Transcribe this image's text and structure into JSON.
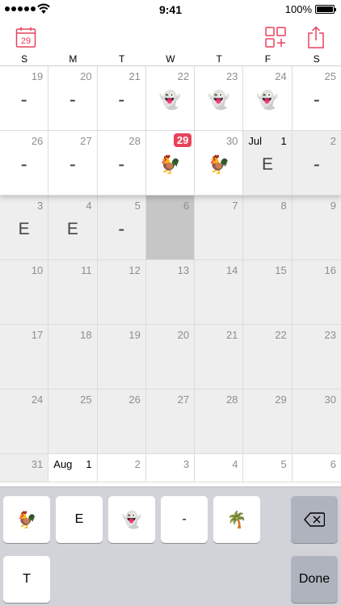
{
  "status_bar": {
    "time": "9:41",
    "battery": "100%"
  },
  "toolbar": {
    "calendar_day": "29",
    "left_icon": "calendar-icon",
    "grid_icon": "grid-add-icon",
    "share_icon": "share-icon",
    "accent": "#e8425a"
  },
  "weekdays": [
    "S",
    "M",
    "T",
    "W",
    "T",
    "F",
    "S"
  ],
  "weeks": [
    [
      {
        "day": "19",
        "mark": "-",
        "state": "active"
      },
      {
        "day": "20",
        "mark": "-",
        "state": "active"
      },
      {
        "day": "21",
        "mark": "-",
        "state": "active"
      },
      {
        "day": "22",
        "mark": "👻",
        "state": "active"
      },
      {
        "day": "23",
        "mark": "👻",
        "state": "active"
      },
      {
        "day": "24",
        "mark": "👻",
        "state": "active"
      },
      {
        "day": "25",
        "mark": "-",
        "state": "active"
      }
    ],
    [
      {
        "day": "26",
        "mark": "-",
        "state": "active"
      },
      {
        "day": "27",
        "mark": "-",
        "state": "active"
      },
      {
        "day": "28",
        "mark": "-",
        "state": "active"
      },
      {
        "day": "29",
        "mark": "🐓",
        "state": "active",
        "today": true
      },
      {
        "day": "30",
        "mark": "🐓",
        "state": "active"
      },
      {
        "day": "1",
        "month": "Jul",
        "mark": "E",
        "state": "inactive"
      },
      {
        "day": "2",
        "mark": "-",
        "state": "inactive"
      }
    ],
    [
      {
        "day": "3",
        "mark": "E",
        "state": "inactive"
      },
      {
        "day": "4",
        "mark": "E",
        "state": "inactive"
      },
      {
        "day": "5",
        "mark": "-",
        "state": "inactive"
      },
      {
        "day": "6",
        "mark": "",
        "state": "selected"
      },
      {
        "day": "7",
        "mark": "",
        "state": "inactive"
      },
      {
        "day": "8",
        "mark": "",
        "state": "inactive"
      },
      {
        "day": "9",
        "mark": "",
        "state": "inactive"
      }
    ],
    [
      {
        "day": "10",
        "mark": "",
        "state": "inactive"
      },
      {
        "day": "11",
        "mark": "",
        "state": "inactive"
      },
      {
        "day": "12",
        "mark": "",
        "state": "inactive"
      },
      {
        "day": "13",
        "mark": "",
        "state": "inactive"
      },
      {
        "day": "14",
        "mark": "",
        "state": "inactive"
      },
      {
        "day": "15",
        "mark": "",
        "state": "inactive"
      },
      {
        "day": "16",
        "mark": "",
        "state": "inactive"
      }
    ],
    [
      {
        "day": "17",
        "mark": "",
        "state": "inactive"
      },
      {
        "day": "18",
        "mark": "",
        "state": "inactive"
      },
      {
        "day": "19",
        "mark": "",
        "state": "inactive"
      },
      {
        "day": "20",
        "mark": "",
        "state": "inactive"
      },
      {
        "day": "21",
        "mark": "",
        "state": "inactive"
      },
      {
        "day": "22",
        "mark": "",
        "state": "inactive"
      },
      {
        "day": "23",
        "mark": "",
        "state": "inactive"
      }
    ],
    [
      {
        "day": "24",
        "mark": "",
        "state": "inactive"
      },
      {
        "day": "25",
        "mark": "",
        "state": "inactive"
      },
      {
        "day": "26",
        "mark": "",
        "state": "inactive"
      },
      {
        "day": "27",
        "mark": "",
        "state": "inactive"
      },
      {
        "day": "28",
        "mark": "",
        "state": "inactive"
      },
      {
        "day": "29",
        "mark": "",
        "state": "inactive"
      },
      {
        "day": "30",
        "mark": "",
        "state": "inactive"
      }
    ],
    [
      {
        "day": "31",
        "mark": "",
        "state": "inactive"
      },
      {
        "day": "1",
        "month": "Aug",
        "mark": "",
        "state": "active"
      },
      {
        "day": "2",
        "mark": "",
        "state": "active"
      },
      {
        "day": "3",
        "mark": "",
        "state": "active"
      },
      {
        "day": "4",
        "mark": "",
        "state": "active"
      },
      {
        "day": "5",
        "mark": "",
        "state": "active"
      },
      {
        "day": "6",
        "mark": "",
        "state": "active"
      }
    ]
  ],
  "keyboard": {
    "keys": [
      "🐓",
      "E",
      "👻",
      "-",
      "🌴"
    ],
    "key_t": "T",
    "delete_icon": "backspace-icon",
    "done": "Done"
  }
}
